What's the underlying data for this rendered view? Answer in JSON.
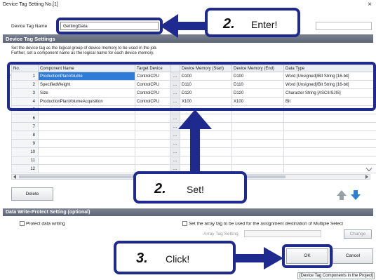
{
  "window": {
    "title": "Device Tag Setting No.[1]",
    "close_glyph": "×"
  },
  "device_tag_name": {
    "label": "Device Tag Name",
    "value": "GettingData"
  },
  "device_tag_settings": {
    "header": "Device Tag Settings",
    "help_line1": "Set the device tag as the logical group of device memory to be used in the job.",
    "help_line2": "Further, set a component name as the logical name for each device memory."
  },
  "table": {
    "columns": [
      "No.",
      "Component Name",
      "Target Device",
      "",
      "Device Memory (Start)",
      "Device Memory (End)",
      "Data Type"
    ],
    "rows": [
      {
        "no": "1",
        "name": "ProductionPlanVolume",
        "target": "ControlCPU",
        "btn": "...",
        "start": "D100",
        "end": "D100",
        "type": "Word [Unsigned]/Bit String [16-bit]"
      },
      {
        "no": "2",
        "name": "SpecifiedWeight",
        "target": "ControlCPU",
        "btn": "...",
        "start": "D110",
        "end": "D110",
        "type": "Word [Unsigned]/Bit String [16-bit]"
      },
      {
        "no": "3",
        "name": "Size",
        "target": "ControlCPU",
        "btn": "...",
        "start": "D120",
        "end": "D120",
        "type": "Character String [ASCII/SJIS]"
      },
      {
        "no": "4",
        "name": "ProductionPlanVolumeAcquisition",
        "target": "ControlCPU",
        "btn": "...",
        "start": "X100",
        "end": "X100",
        "type": "Bit"
      },
      {
        "no": "5",
        "name": "",
        "target": "",
        "btn": "...",
        "start": "",
        "end": "",
        "type": ""
      },
      {
        "no": "6",
        "name": "",
        "target": "",
        "btn": "...",
        "start": "",
        "end": "",
        "type": ""
      },
      {
        "no": "7",
        "name": "",
        "target": "",
        "btn": "...",
        "start": "",
        "end": "",
        "type": ""
      },
      {
        "no": "8",
        "name": "",
        "target": "",
        "btn": "...",
        "start": "",
        "end": "",
        "type": ""
      },
      {
        "no": "9",
        "name": "",
        "target": "",
        "btn": "...",
        "start": "",
        "end": "",
        "type": ""
      },
      {
        "no": "10",
        "name": "",
        "target": "",
        "btn": "...",
        "start": "",
        "end": "",
        "type": ""
      },
      {
        "no": "11",
        "name": "",
        "target": "",
        "btn": "...",
        "start": "",
        "end": "",
        "type": ""
      },
      {
        "no": "12",
        "name": "",
        "target": "",
        "btn": "...",
        "start": "",
        "end": "",
        "type": ""
      }
    ]
  },
  "buttons": {
    "delete": "Delete",
    "ok": "OK",
    "cancel": "Cancel",
    "change": "Change"
  },
  "write_protect": {
    "header": "Data Write-Protect Setting (optional)",
    "protect_label": "Protect data writing",
    "array_label": "Set the array tag to be used for the assignment destination of Multiple Select",
    "array_tag_label": "Array Tag Setting"
  },
  "footer": {
    "components_link": "[Device Tag Components in the Project]"
  },
  "callouts": {
    "enter": {
      "num": "2.",
      "text": "Enter!"
    },
    "set": {
      "num": "2.",
      "text": "Set!"
    },
    "click": {
      "num": "3.",
      "text": "Click!"
    }
  },
  "colors": {
    "callout_border": "#1f2a8f",
    "selection": "#2f7bd8",
    "section_bar": "#6b7280",
    "nav_arrow": "#2d7fd3"
  }
}
